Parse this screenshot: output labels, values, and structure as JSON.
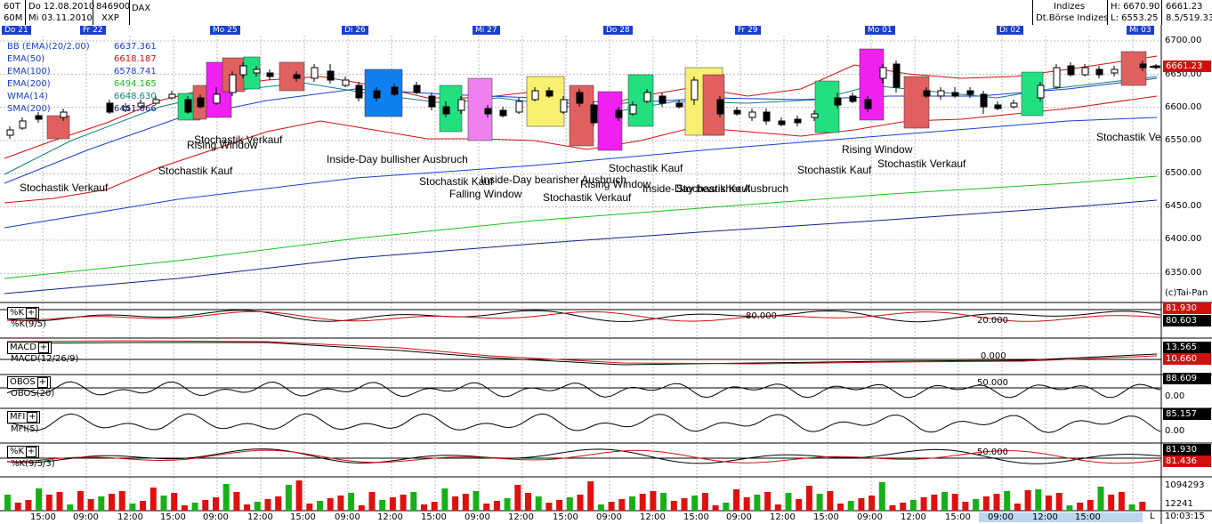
{
  "header": {
    "period1": "60T",
    "date1": "Do 12.08.2010",
    "code": "846900",
    "name": "DAX",
    "period2": "60M",
    "date2": "Mi 03.11.2010",
    "exchange": "XXP",
    "category": "Indizes",
    "subcategory": "Dt.Börse Indizes",
    "high": "H: 6670.90",
    "low": "L: 6553.25",
    "last": "6661.23",
    "change": "8.5/519.33"
  },
  "dates": [
    "Do 21",
    "Fr 22",
    "Mo 25",
    "Di 26",
    "Mi 27",
    "Do 28",
    "Fr 29",
    "Mo 01",
    "Di 02",
    "Mi 03"
  ],
  "indicators": [
    {
      "name": "BB (EMA)(20/2.00)",
      "value": "6637.361",
      "color": "#1a3fd0"
    },
    {
      "name": "EMA(50)",
      "value": "6618.187",
      "color": "#d01010"
    },
    {
      "name": "EMA(100)",
      "value": "6578.741",
      "color": "#1a3fd0"
    },
    {
      "name": "EMA(200)",
      "value": "6494.165",
      "color": "#18c018"
    },
    {
      "name": "WMA(14)",
      "value": "6648.630",
      "color": "#128080"
    },
    {
      "name": "SMA(200)",
      "value": "6461.666",
      "color": "#10208a"
    }
  ],
  "price_axis": [
    "6700.00",
    "6650.00",
    "6600.00",
    "6550.00",
    "6500.00",
    "6450.00",
    "6400.00",
    "6350.00"
  ],
  "current_price": "6661.23",
  "copyright": "(c)Tai-Pan",
  "annotations": [
    {
      "text": "Stochastik Verkauf"
    },
    {
      "text": "Stochastik Kauf"
    },
    {
      "text": "Rising Window"
    },
    {
      "text": "Stochastik Verkauf"
    },
    {
      "text": "Inside-Day bullisher Ausbruch"
    },
    {
      "text": "Stochastik Kauf"
    },
    {
      "text": "Falling Window"
    },
    {
      "text": "Inside-Day bearisher Ausbruch"
    },
    {
      "text": "Rising Window"
    },
    {
      "text": "Stochastik Verkauf"
    },
    {
      "text": "Stochastik Kauf"
    },
    {
      "text": "Inside-Day bearisher Ausbruch"
    },
    {
      "text": "Stochastik Kauf"
    },
    {
      "text": "Rising Window"
    },
    {
      "text": "Stochastik Verkauf"
    },
    {
      "text": "Stochastik Kauf"
    },
    {
      "text": "Stochastik Ve"
    }
  ],
  "panels": [
    {
      "button": "%K",
      "label": "%K(9/5)",
      "level": "80.000",
      "level2": "20.000",
      "v1": "81.930",
      "v2": "80.603",
      "c1": "#d01010",
      "c2": "#000000"
    },
    {
      "button": "MACD",
      "label": "MACD(12/26/9)",
      "level": "0.000",
      "v1": "13.565",
      "v2": "10.660",
      "c1": "#000000",
      "c2": "#d01010"
    },
    {
      "button": "OBOS",
      "label": "OBOS(20)",
      "level": "50.000",
      "v1": "88.609",
      "v2": "0.00",
      "c1": "#000000",
      "c2": ""
    },
    {
      "button": "MFI",
      "label": "MFI(5)",
      "level": "",
      "v1": "85.157",
      "v2": "0.00",
      "c1": "#000000",
      "c2": ""
    },
    {
      "button": "%K",
      "label": "%K(9/5/3)",
      "level": "50.000",
      "v1": "81.930",
      "v2": "81.436",
      "c1": "#000000",
      "c2": "#d01010"
    }
  ],
  "volume_axis": [
    "1094293",
    "12241"
  ],
  "time_labels": [
    "15:00",
    "09:00",
    "12:00",
    "15:00",
    "09:00",
    "12:00",
    "15:00",
    "09:00",
    "12:00",
    "15:00",
    "09:00",
    "12:00",
    "15:00",
    "09:00",
    "12:00",
    "15:00",
    "09:00",
    "12:00",
    "15:00",
    "09:00",
    "12:00",
    "15:00",
    "09:00",
    "12:00",
    "15:00"
  ],
  "clock": "10:03:15",
  "scroll_label": "L"
}
